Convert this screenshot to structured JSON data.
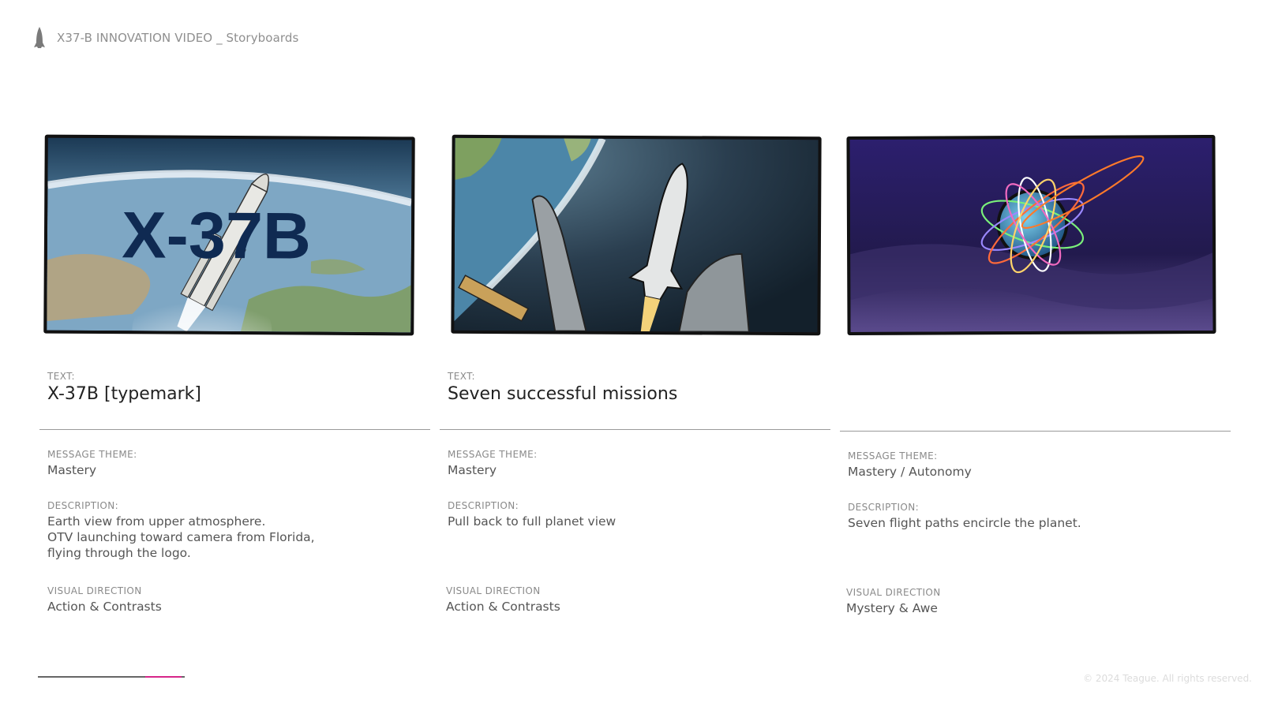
{
  "header": {
    "title": "X37-B INNOVATION VIDEO _ Storyboards",
    "icon": "rocket-icon"
  },
  "panels": [
    {
      "frame_overlay_text": "X-37B",
      "text_label": "TEXT:",
      "text_value": "X-37B [typemark]",
      "theme_label": "MESSAGE THEME:",
      "theme_value": "Mastery",
      "description_label": "DESCRIPTION:",
      "description_lines": [
        "Earth view from upper atmosphere.",
        "OTV launching toward camera from Florida,",
        "flying through the logo."
      ],
      "visual_label": "VISUAL DIRECTION",
      "visual_value": "Action & Contrasts"
    },
    {
      "text_label": "TEXT:",
      "text_value": "Seven successful missions",
      "theme_label": "MESSAGE THEME:",
      "theme_value": "Mastery",
      "description_label": "DESCRIPTION:",
      "description_lines": [
        "Pull back to full planet view"
      ],
      "visual_label": "VISUAL DIRECTION",
      "visual_value": "Action & Contrasts"
    },
    {
      "text_label": "",
      "text_value": "",
      "theme_label": "MESSAGE THEME:",
      "theme_value": "Mastery / Autonomy",
      "description_label": "DESCRIPTION:",
      "description_lines": [
        "Seven flight paths encircle the planet."
      ],
      "visual_label": "VISUAL DIRECTION",
      "visual_value": "Mystery & Awe"
    }
  ],
  "footer": {
    "copyright": "© 2024 Teague. All rights reserved.",
    "progress": {
      "start_fraction": 0.73,
      "end_fraction": 0.98
    }
  },
  "colors": {
    "accent": "#d6258a",
    "typemark": "#0f2a52"
  }
}
